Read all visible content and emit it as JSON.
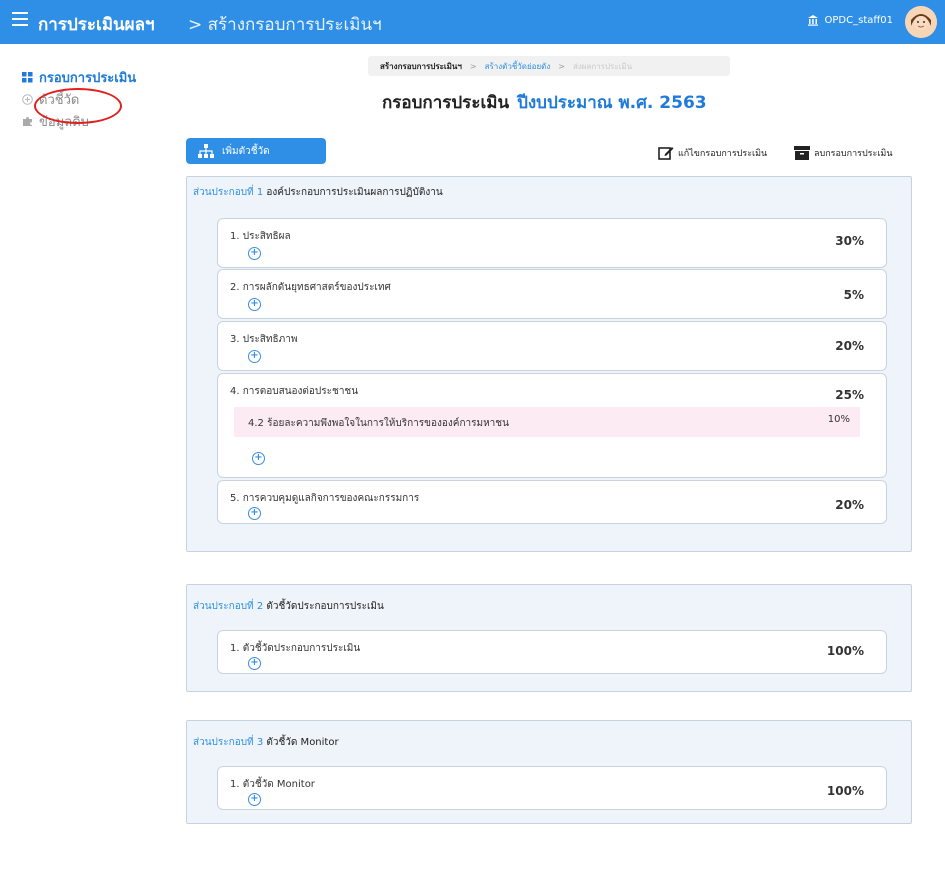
{
  "header": {
    "title": "การประเมินผลฯ",
    "breadcrumb": "> สร้างกรอบการประเมินฯ",
    "user": "OPDC_staff01"
  },
  "sidebar": {
    "items": [
      {
        "label": "กรอบการประเมิน",
        "icon": "grid-icon"
      },
      {
        "label": "ตัวชี้วัด",
        "icon": "plus-circle-icon"
      },
      {
        "label": "ข้อมูลดิบ",
        "icon": "puzzle-icon"
      }
    ]
  },
  "steps": {
    "step1": "สร้างกรอบการประเมินฯ",
    "sep": ">",
    "step2": "สร้างตัวชี้วัดย่อยดัง",
    "step3": "ส่งผลการประเมิน"
  },
  "page": {
    "title": "กรอบการประเมิน",
    "year": "ปีงบประมาณ พ.ศ. 2563"
  },
  "toolbar": {
    "add_label": "เพิ่มตัวชี้วัด",
    "edit_label": "แก้ไขกรอบการประเมิน",
    "delete_label": "ลบกรอบการประเมิน"
  },
  "sections": [
    {
      "num": "ส่วนประกอบที่ 1",
      "title": "องค์ประกอบการประเมินผลการปฏิบัติงาน",
      "items": [
        {
          "label": "1. ประสิทธิผล",
          "pct": "30%"
        },
        {
          "label": "2. การผลักดันยุทธศาสตร์ของประเทศ",
          "pct": "5%"
        },
        {
          "label": "3. ประสิทธิภาพ",
          "pct": "20%"
        },
        {
          "label": "4. การตอบสนองต่อประชาชน",
          "pct": "25%",
          "sub": {
            "label": "4.2 ร้อยละความพึงพอใจในการให้บริการขององค์การมหาชน",
            "pct": "10%"
          }
        },
        {
          "label": "5. การควบคุมดูแลกิจการของคณะกรรมการ",
          "pct": "20%"
        }
      ]
    },
    {
      "num": "ส่วนประกอบที่ 2",
      "title": "ตัวชี้วัดประกอบการประเมิน",
      "items": [
        {
          "label": "1. ตัวชี้วัดประกอบการประเมิน",
          "pct": "100%"
        }
      ]
    },
    {
      "num": "ส่วนประกอบที่ 3",
      "title": "ตัวชี้วัด Monitor",
      "items": [
        {
          "label": "1. ตัวชี้วัด Monitor",
          "pct": "100%"
        }
      ]
    }
  ],
  "colors": {
    "primary": "#2f8fe6",
    "section_bg": "#eef4fa",
    "highlight": "#fcebf3",
    "annotation": "#e02020"
  }
}
